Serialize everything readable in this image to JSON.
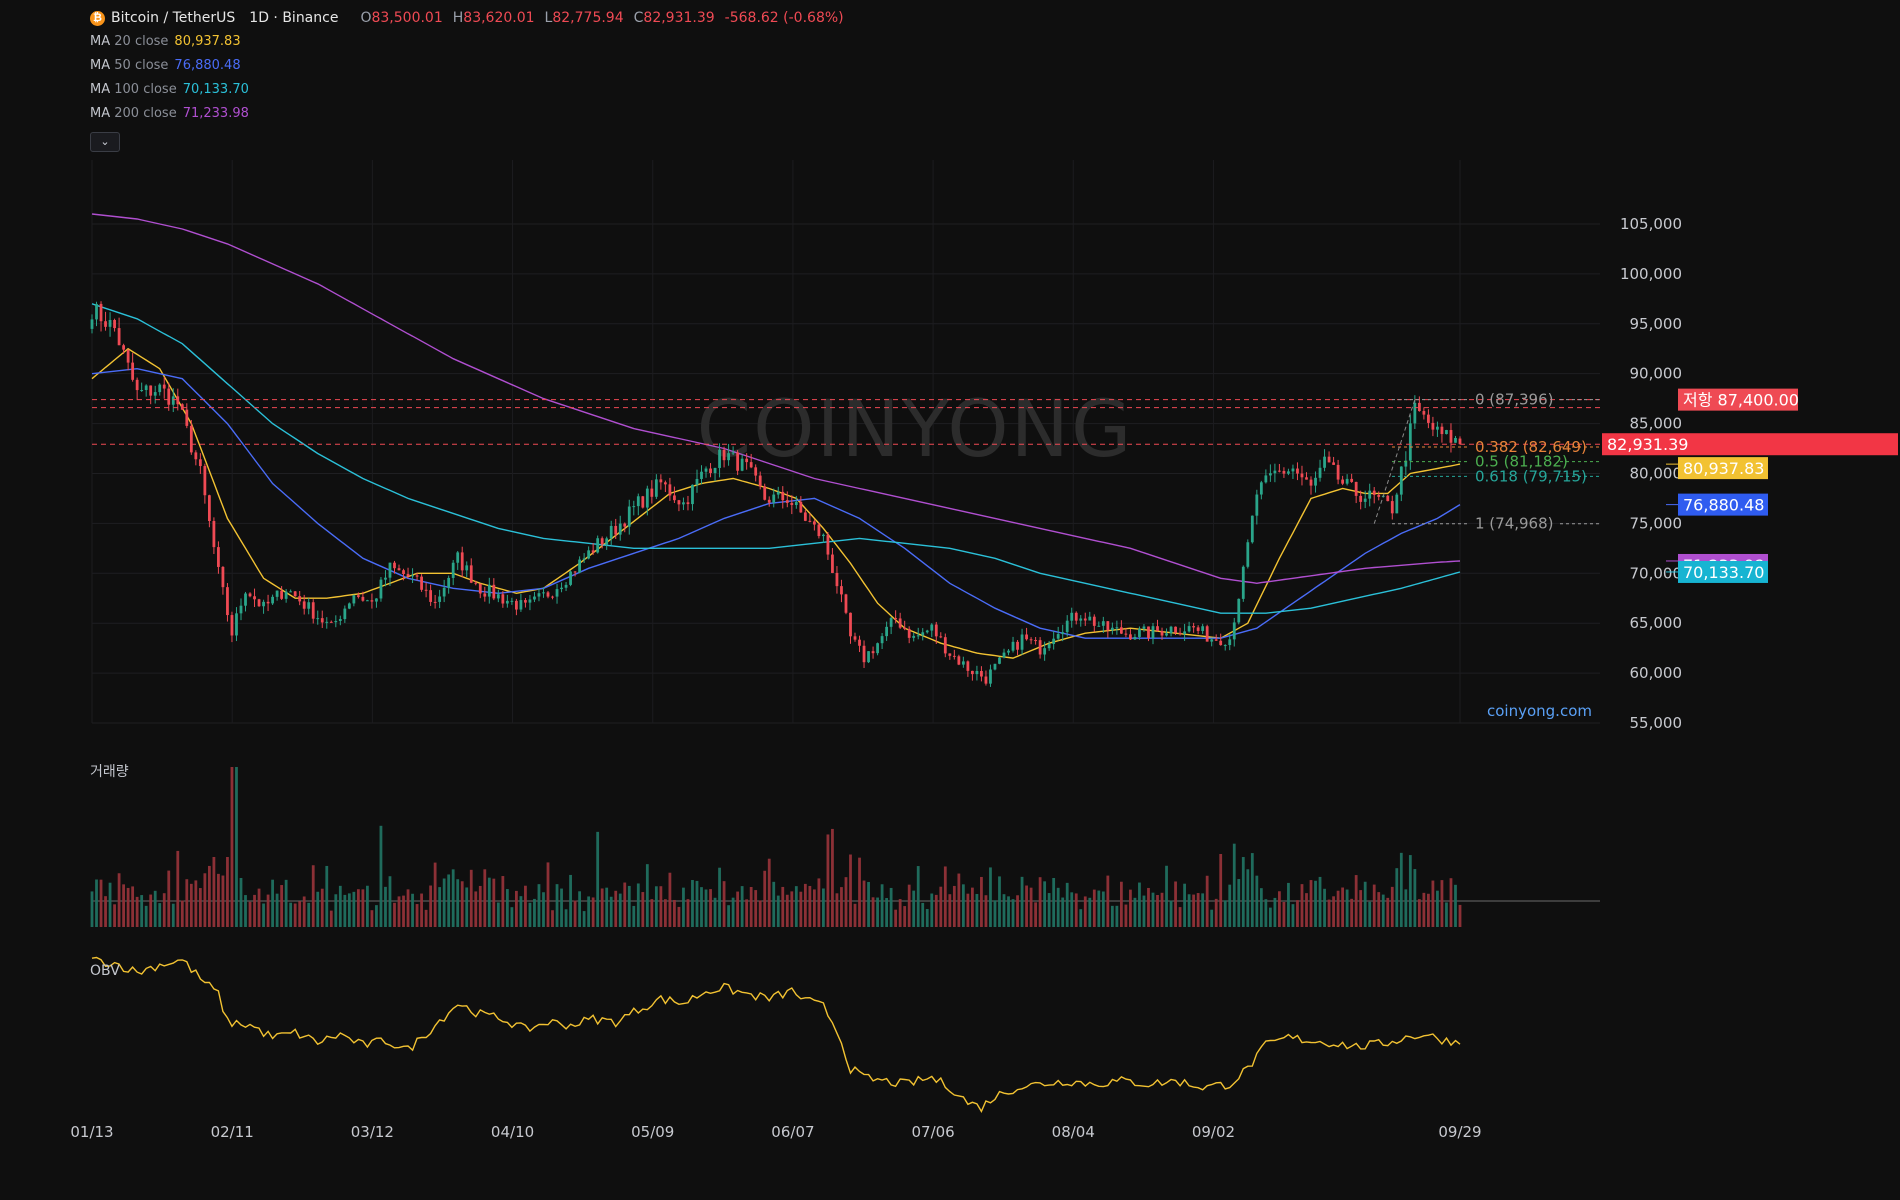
{
  "header": {
    "symbol": "Bitcoin / TetherUS",
    "timeframe": "1D · Binance",
    "ohlc": {
      "o_label": "O",
      "o": "83,500.01",
      "h_label": "H",
      "h": "83,620.01",
      "l_label": "L",
      "l": "82,775.94",
      "c_label": "C",
      "c": "82,931.39",
      "change": "-568.62 (-0.68%)"
    }
  },
  "ma_legend": [
    {
      "name": "MA",
      "len": "20",
      "src": "close",
      "value": "80,937.83",
      "color": "#f2c232"
    },
    {
      "name": "MA",
      "len": "50",
      "src": "close",
      "value": "76,880.48",
      "color": "#4a6cf7"
    },
    {
      "name": "MA",
      "len": "100",
      "src": "close",
      "value": "70,133.70",
      "color": "#2bc0d8"
    },
    {
      "name": "MA",
      "len": "200",
      "src": "close",
      "value": "71,233.98",
      "color": "#b04fd0"
    }
  ],
  "watermark": "COINYONG",
  "site_label": "coinyong.com",
  "volume_label": "거래량",
  "obv_label": "OBV",
  "colors": {
    "up": "#2aa58a",
    "down": "#ef4a54",
    "ma20": "#f2c232",
    "ma50": "#4a6cf7",
    "ma100": "#2bc0d8",
    "ma200": "#b04fd0",
    "obv": "#f2c232",
    "fib": "#b3b3b3"
  },
  "chart_data": {
    "type": "candlestick",
    "x_tick_labels": [
      "01/13",
      "02/11",
      "03/12",
      "04/10",
      "05/09",
      "06/07",
      "07/06",
      "08/04",
      "09/02",
      "09/29"
    ],
    "x_range": [
      "01/13",
      "09/29"
    ],
    "y_ticks": [
      "105,000",
      "100,000",
      "95,000",
      "90,000",
      "85,000",
      "80,000",
      "75,000",
      "70,000",
      "65,000",
      "60,000",
      "55,000"
    ],
    "ylim": [
      55000,
      107000
    ],
    "close_anchors": [
      [
        0,
        96500
      ],
      [
        5,
        94500
      ],
      [
        10,
        88000
      ],
      [
        15,
        88500
      ],
      [
        19,
        87000
      ],
      [
        24,
        80000
      ],
      [
        28,
        70000
      ],
      [
        31,
        64000
      ],
      [
        34,
        68500
      ],
      [
        38,
        66500
      ],
      [
        43,
        68500
      ],
      [
        48,
        66500
      ],
      [
        53,
        64500
      ],
      [
        58,
        68000
      ],
      [
        62,
        67000
      ],
      [
        66,
        70500
      ],
      [
        71,
        69500
      ],
      [
        76,
        67000
      ],
      [
        81,
        71500
      ],
      [
        86,
        68500
      ],
      [
        91,
        67500
      ],
      [
        96,
        66500
      ],
      [
        101,
        68000
      ],
      [
        106,
        70000
      ],
      [
        111,
        72500
      ],
      [
        116,
        74500
      ],
      [
        121,
        77000
      ],
      [
        126,
        79000
      ],
      [
        131,
        77000
      ],
      [
        136,
        80500
      ],
      [
        140,
        82000
      ],
      [
        145,
        80500
      ],
      [
        149,
        77500
      ],
      [
        154,
        77500
      ],
      [
        158,
        75500
      ],
      [
        162,
        73500
      ],
      [
        165,
        69000
      ],
      [
        168,
        63500
      ],
      [
        171,
        61500
      ],
      [
        174,
        63000
      ],
      [
        178,
        65500
      ],
      [
        182,
        63500
      ],
      [
        186,
        64500
      ],
      [
        190,
        62000
      ],
      [
        194,
        60500
      ],
      [
        198,
        59500
      ],
      [
        202,
        61500
      ],
      [
        206,
        63500
      ],
      [
        210,
        62500
      ],
      [
        214,
        64500
      ],
      [
        219,
        66000
      ],
      [
        224,
        64500
      ],
      [
        229,
        64000
      ],
      [
        234,
        64000
      ],
      [
        239,
        64500
      ],
      [
        244,
        64500
      ],
      [
        248,
        63500
      ],
      [
        252,
        63500
      ],
      [
        255,
        70000
      ],
      [
        258,
        78000
      ],
      [
        262,
        80000
      ],
      [
        266,
        80500
      ],
      [
        270,
        78500
      ],
      [
        273,
        81000
      ],
      [
        277,
        79000
      ],
      [
        280,
        78000
      ],
      [
        284,
        77500
      ],
      [
        288,
        76500
      ],
      [
        291,
        82000
      ],
      [
        293,
        86500
      ],
      [
        295,
        85500
      ],
      [
        298,
        84000
      ],
      [
        301,
        83500
      ],
      [
        303,
        82931
      ]
    ],
    "series": [
      {
        "name": "MA 20 close",
        "last": 80937.83,
        "anchors": [
          [
            0,
            89500
          ],
          [
            8,
            92500
          ],
          [
            15,
            90500
          ],
          [
            22,
            85000
          ],
          [
            30,
            75500
          ],
          [
            38,
            69500
          ],
          [
            45,
            67500
          ],
          [
            52,
            67500
          ],
          [
            60,
            68000
          ],
          [
            66,
            69000
          ],
          [
            72,
            70000
          ],
          [
            80,
            70000
          ],
          [
            86,
            69000
          ],
          [
            94,
            68000
          ],
          [
            100,
            68500
          ],
          [
            108,
            71000
          ],
          [
            118,
            74500
          ],
          [
            128,
            78000
          ],
          [
            135,
            79000
          ],
          [
            142,
            79500
          ],
          [
            150,
            78500
          ],
          [
            156,
            77500
          ],
          [
            162,
            74500
          ],
          [
            168,
            71000
          ],
          [
            174,
            67000
          ],
          [
            180,
            64500
          ],
          [
            188,
            63000
          ],
          [
            196,
            62000
          ],
          [
            204,
            61500
          ],
          [
            212,
            63000
          ],
          [
            220,
            64000
          ],
          [
            230,
            64500
          ],
          [
            240,
            64000
          ],
          [
            250,
            63500
          ],
          [
            256,
            65000
          ],
          [
            263,
            71500
          ],
          [
            270,
            77500
          ],
          [
            277,
            78500
          ],
          [
            282,
            78000
          ],
          [
            287,
            78000
          ],
          [
            292,
            80000
          ],
          [
            298,
            80500
          ],
          [
            303,
            80938
          ]
        ]
      },
      {
        "name": "MA 50 close",
        "last": 76880.48,
        "anchors": [
          [
            0,
            90000
          ],
          [
            10,
            90500
          ],
          [
            20,
            89500
          ],
          [
            30,
            85000
          ],
          [
            40,
            79000
          ],
          [
            50,
            75000
          ],
          [
            60,
            71500
          ],
          [
            70,
            69500
          ],
          [
            80,
            68500
          ],
          [
            90,
            68000
          ],
          [
            100,
            68500
          ],
          [
            110,
            70500
          ],
          [
            120,
            72000
          ],
          [
            130,
            73500
          ],
          [
            140,
            75500
          ],
          [
            150,
            77000
          ],
          [
            160,
            77500
          ],
          [
            170,
            75500
          ],
          [
            180,
            72500
          ],
          [
            190,
            69000
          ],
          [
            200,
            66500
          ],
          [
            210,
            64500
          ],
          [
            220,
            63500
          ],
          [
            230,
            63500
          ],
          [
            240,
            63500
          ],
          [
            250,
            63500
          ],
          [
            258,
            64500
          ],
          [
            266,
            67000
          ],
          [
            274,
            69500
          ],
          [
            282,
            72000
          ],
          [
            290,
            74000
          ],
          [
            298,
            75500
          ],
          [
            303,
            76880
          ]
        ]
      },
      {
        "name": "MA 100 close",
        "last": 70133.7,
        "anchors": [
          [
            0,
            97000
          ],
          [
            10,
            95500
          ],
          [
            20,
            93000
          ],
          [
            30,
            89000
          ],
          [
            40,
            85000
          ],
          [
            50,
            82000
          ],
          [
            60,
            79500
          ],
          [
            70,
            77500
          ],
          [
            80,
            76000
          ],
          [
            90,
            74500
          ],
          [
            100,
            73500
          ],
          [
            110,
            73000
          ],
          [
            120,
            72500
          ],
          [
            130,
            72500
          ],
          [
            140,
            72500
          ],
          [
            150,
            72500
          ],
          [
            160,
            73000
          ],
          [
            170,
            73500
          ],
          [
            180,
            73000
          ],
          [
            190,
            72500
          ],
          [
            200,
            71500
          ],
          [
            210,
            70000
          ],
          [
            220,
            69000
          ],
          [
            230,
            68000
          ],
          [
            240,
            67000
          ],
          [
            250,
            66000
          ],
          [
            260,
            66000
          ],
          [
            270,
            66500
          ],
          [
            280,
            67500
          ],
          [
            290,
            68500
          ],
          [
            298,
            69500
          ],
          [
            303,
            70134
          ]
        ]
      },
      {
        "name": "MA 200 close",
        "last": 71233.98,
        "anchors": [
          [
            0,
            106000
          ],
          [
            10,
            105500
          ],
          [
            20,
            104500
          ],
          [
            30,
            103000
          ],
          [
            40,
            101000
          ],
          [
            50,
            99000
          ],
          [
            60,
            96500
          ],
          [
            70,
            94000
          ],
          [
            80,
            91500
          ],
          [
            90,
            89500
          ],
          [
            100,
            87500
          ],
          [
            110,
            86000
          ],
          [
            120,
            84500
          ],
          [
            130,
            83500
          ],
          [
            140,
            82500
          ],
          [
            150,
            81000
          ],
          [
            160,
            79500
          ],
          [
            170,
            78500
          ],
          [
            180,
            77500
          ],
          [
            190,
            76500
          ],
          [
            200,
            75500
          ],
          [
            210,
            74500
          ],
          [
            220,
            73500
          ],
          [
            230,
            72500
          ],
          [
            240,
            71000
          ],
          [
            250,
            69500
          ],
          [
            258,
            69000
          ],
          [
            266,
            69500
          ],
          [
            274,
            70000
          ],
          [
            282,
            70500
          ],
          [
            290,
            70800
          ],
          [
            298,
            71100
          ],
          [
            303,
            71234
          ]
        ]
      }
    ],
    "price_labels": [
      {
        "text": "저항 87,400.00",
        "value": 87400,
        "color": "#ef4a54"
      },
      {
        "text": "82,931.39",
        "value": 82931.39,
        "color": "#f23645"
      },
      {
        "text": "80,937.83",
        "value": 80937.83,
        "color": "#f2c232"
      },
      {
        "text": "76,880.48",
        "value": 76880.48,
        "color": "#2f5cf0"
      },
      {
        "text": "71,233.98",
        "value": 71233.98,
        "color": "#b04fd0"
      },
      {
        "text": "70,133.70",
        "value": 70133.7,
        "color": "#17b4d2"
      }
    ],
    "horizontal_lines": [
      {
        "value": 87400,
        "color": "#ef4a54",
        "style": "dashed"
      },
      {
        "value": 86600,
        "color": "#ef4a54",
        "style": "dashed"
      },
      {
        "value": 82931.39,
        "color": "#ef4a54",
        "style": "dashed"
      }
    ],
    "fibonacci": [
      {
        "text": "0 (87,396)",
        "value": 87396,
        "color": "#9a9a9a"
      },
      {
        "text": "0.382 (82,649)",
        "value": 82649,
        "color": "#e8833a"
      },
      {
        "text": "0.5 (81,182)",
        "value": 81182,
        "color": "#4caf50"
      },
      {
        "text": "0.618 (79,715)",
        "value": 79715,
        "color": "#26a69a"
      },
      {
        "text": "1 (74,968)",
        "value": 74968,
        "color": "#9a9a9a"
      }
    ],
    "obv_anchors": [
      [
        0,
        100
      ],
      [
        5,
        98
      ],
      [
        10,
        92
      ],
      [
        15,
        97
      ],
      [
        20,
        100
      ],
      [
        24,
        88
      ],
      [
        28,
        78
      ],
      [
        30,
        60
      ],
      [
        35,
        58
      ],
      [
        40,
        50
      ],
      [
        45,
        53
      ],
      [
        50,
        47
      ],
      [
        55,
        52
      ],
      [
        60,
        45
      ],
      [
        65,
        48
      ],
      [
        70,
        42
      ],
      [
        76,
        58
      ],
      [
        81,
        72
      ],
      [
        86,
        65
      ],
      [
        91,
        62
      ],
      [
        96,
        55
      ],
      [
        101,
        60
      ],
      [
        106,
        58
      ],
      [
        111,
        62
      ],
      [
        116,
        60
      ],
      [
        121,
        68
      ],
      [
        126,
        75
      ],
      [
        131,
        72
      ],
      [
        136,
        80
      ],
      [
        140,
        82
      ],
      [
        145,
        78
      ],
      [
        150,
        75
      ],
      [
        155,
        80
      ],
      [
        158,
        74
      ],
      [
        162,
        70
      ],
      [
        165,
        55
      ],
      [
        168,
        30
      ],
      [
        171,
        24
      ],
      [
        175,
        22
      ],
      [
        180,
        20
      ],
      [
        186,
        24
      ],
      [
        190,
        18
      ],
      [
        194,
        8
      ],
      [
        197,
        5
      ],
      [
        200,
        12
      ],
      [
        205,
        18
      ],
      [
        210,
        20
      ],
      [
        216,
        22
      ],
      [
        222,
        20
      ],
      [
        228,
        22
      ],
      [
        234,
        20
      ],
      [
        240,
        22
      ],
      [
        246,
        18
      ],
      [
        252,
        20
      ],
      [
        256,
        30
      ],
      [
        260,
        45
      ],
      [
        265,
        50
      ],
      [
        270,
        48
      ],
      [
        276,
        46
      ],
      [
        280,
        44
      ],
      [
        286,
        46
      ],
      [
        291,
        50
      ],
      [
        295,
        52
      ],
      [
        300,
        48
      ],
      [
        303,
        47
      ]
    ]
  }
}
